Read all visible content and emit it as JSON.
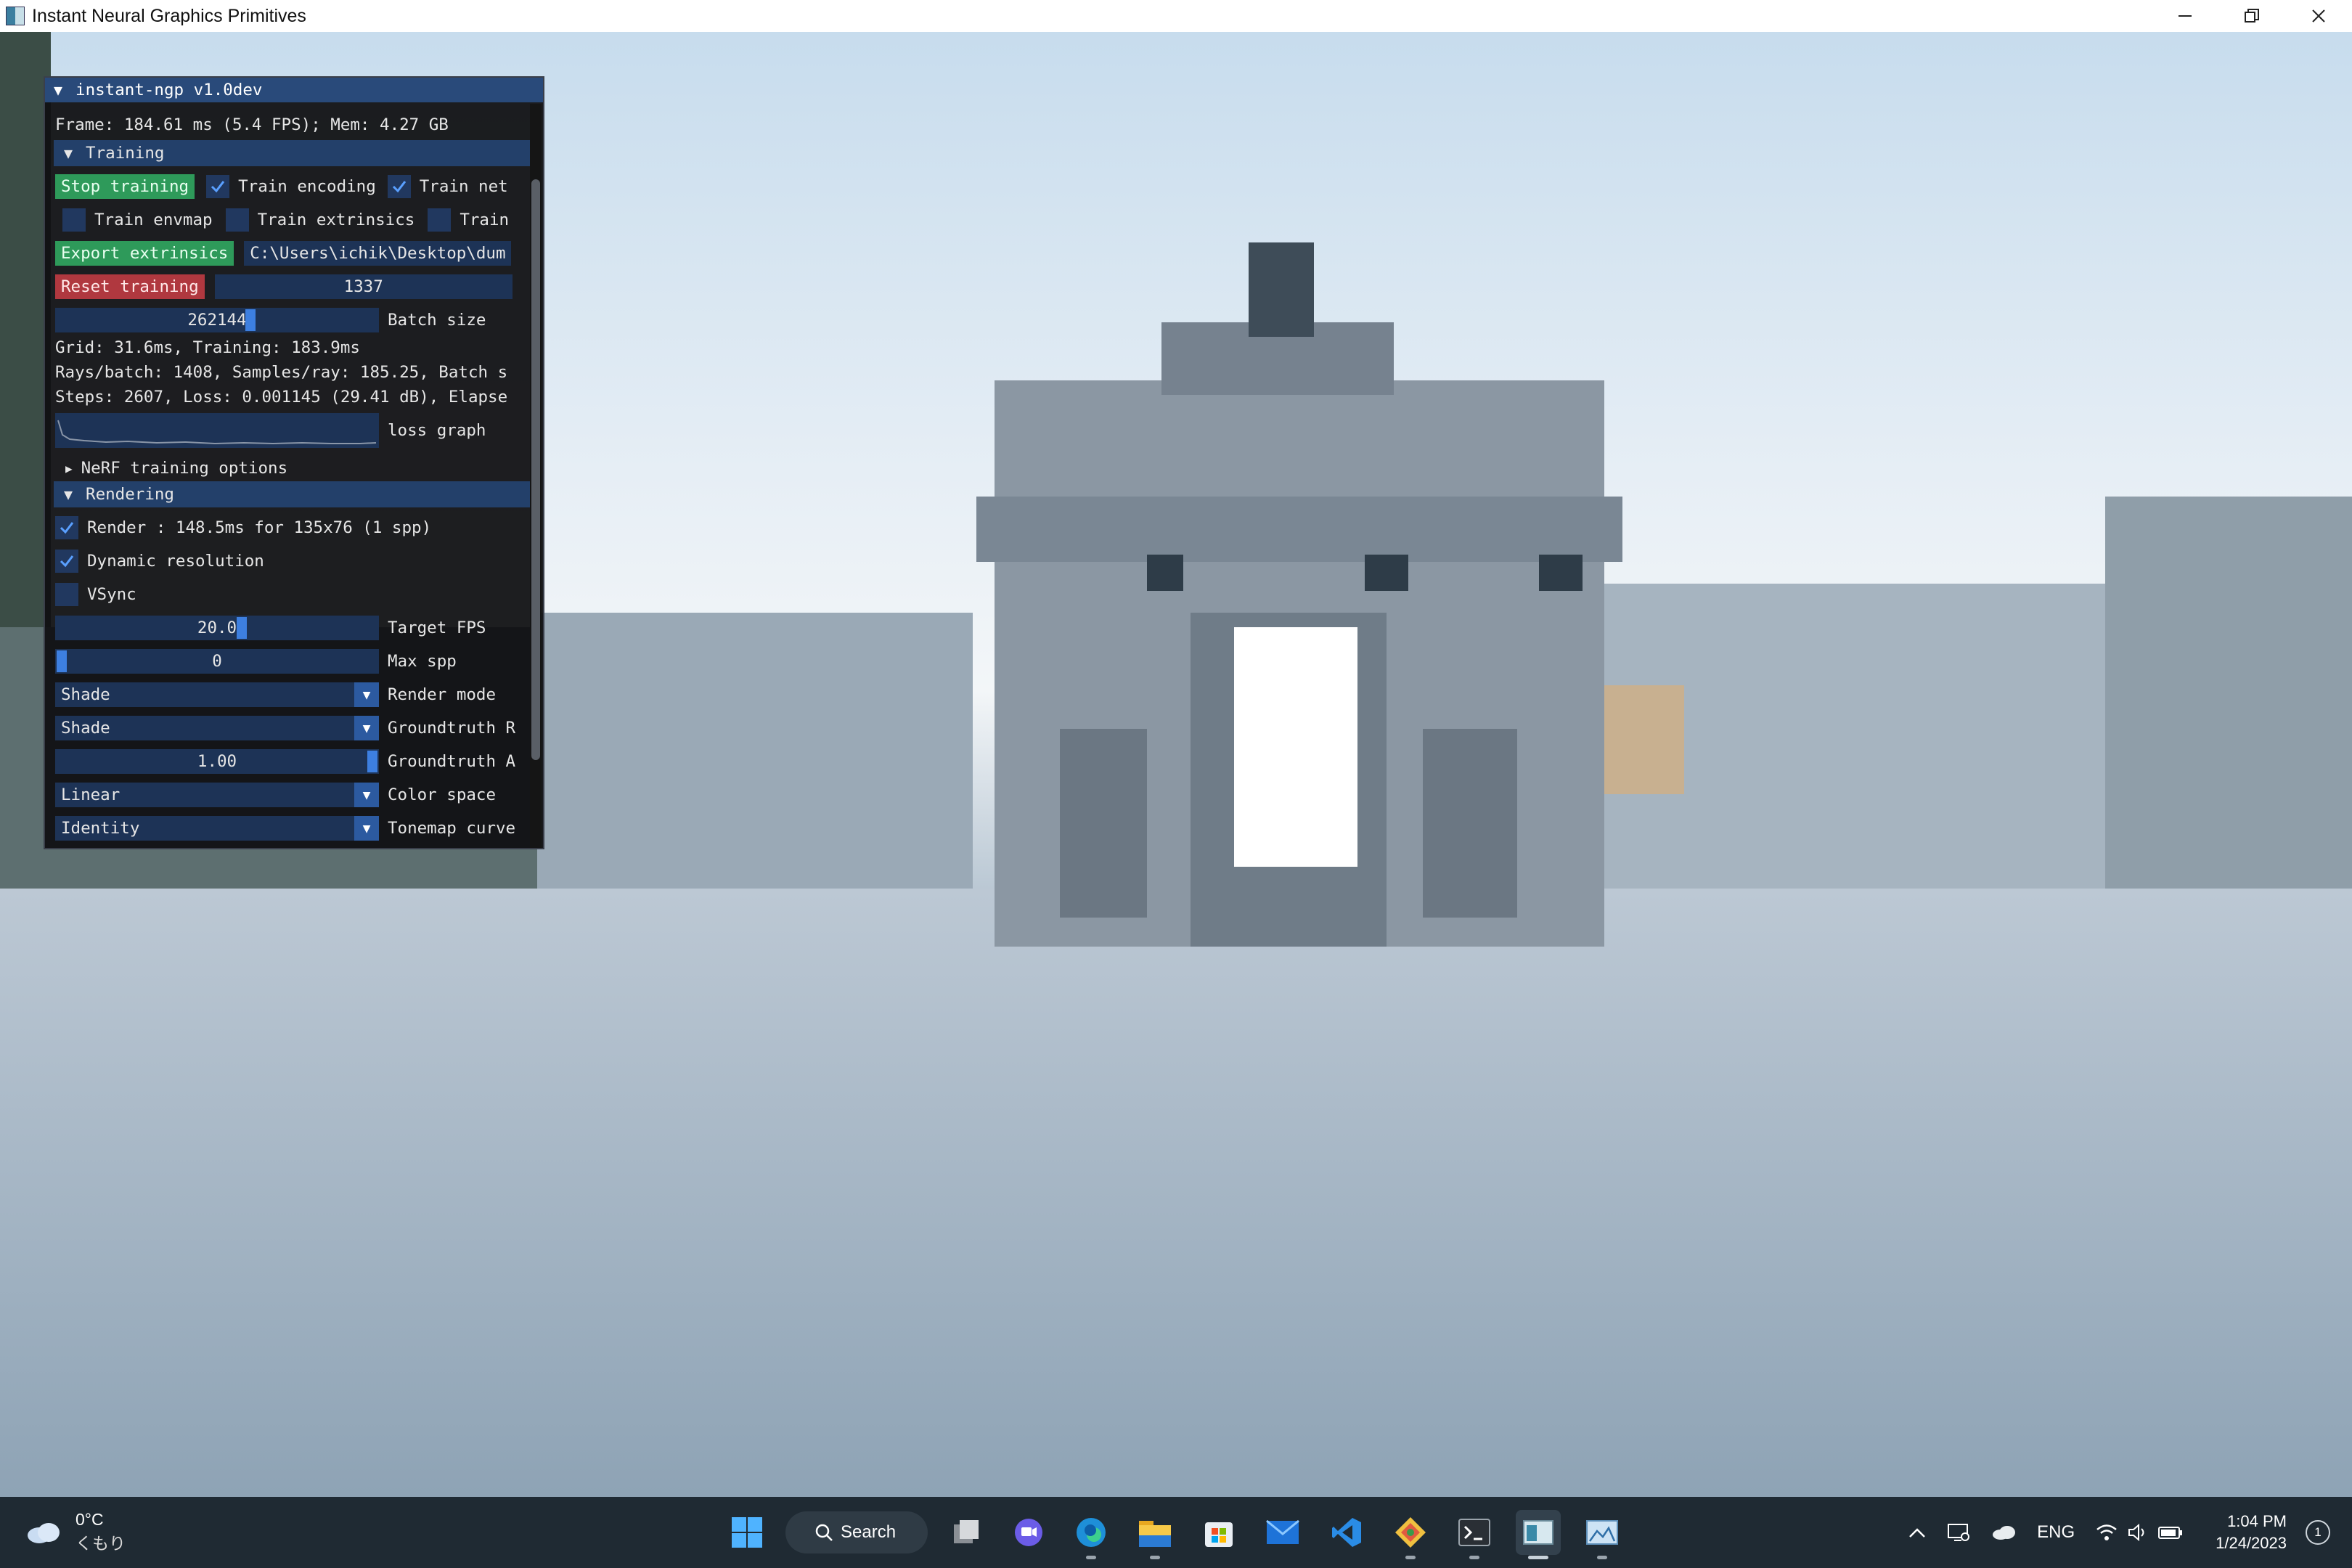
{
  "window": {
    "title": "Instant Neural Graphics Primitives"
  },
  "panel": {
    "title": "instant-ngp v1.0dev",
    "frame_stats": "Frame: 184.61 ms (5.4 FPS); Mem: 4.27 GB",
    "training": {
      "header": "Training",
      "stop_training": "Stop training",
      "train_encoding": "Train encoding",
      "train_encoding_checked": true,
      "train_net": "Train net",
      "train_net_checked": true,
      "train_envmap": "Train envmap",
      "train_extrinsics": "Train extrinsics",
      "train_more": "Train",
      "export_extrinsics": "Export extrinsics",
      "export_path": "C:\\Users\\ichik\\Desktop\\dum",
      "reset_training": "Reset training",
      "seed": "1337",
      "batch_size_value": "262144",
      "batch_size_label": "Batch size",
      "timing": "Grid: 31.6ms, Training: 183.9ms",
      "rays": "Rays/batch: 1408, Samples/ray: 185.25, Batch s",
      "steps": "Steps: 2607, Loss: 0.001145 (29.41 dB), Elapse",
      "loss_graph_label": "loss graph",
      "nerf_options": "NeRF training options"
    },
    "rendering": {
      "header": "Rendering",
      "render": "Render : 148.5ms for 135x76 (1 spp)",
      "render_checked": true,
      "dynamic_resolution": "Dynamic resolution",
      "dynamic_resolution_checked": true,
      "vsync": "VSync",
      "vsync_checked": false,
      "target_fps_value": "20.0",
      "target_fps_label": "Target FPS",
      "max_spp_value": "0",
      "max_spp_label": "Max spp",
      "render_mode_value": "Shade",
      "render_mode_label": "Render mode",
      "groundtruth_r_value": "Shade",
      "groundtruth_r_label": "Groundtruth R",
      "groundtruth_a_value": "1.00",
      "groundtruth_a_label": "Groundtruth A",
      "color_space_value": "Linear",
      "color_space_label": "Color space",
      "tonemap_value": "Identity",
      "tonemap_label": "Tonemap curve"
    }
  },
  "taskbar": {
    "weather_temp": "0°C",
    "weather_desc": "くもり",
    "search_label": "Search",
    "language": "ENG",
    "time": "1:04 PM",
    "date": "1/24/2023",
    "notification_count": "1"
  },
  "colors": {
    "panel_title_bg": "#294a7a",
    "header_bg": "#23406a",
    "green_button": "#2e9a5a",
    "red_button": "#b0383f",
    "slider_grab": "#3d7fe0"
  }
}
